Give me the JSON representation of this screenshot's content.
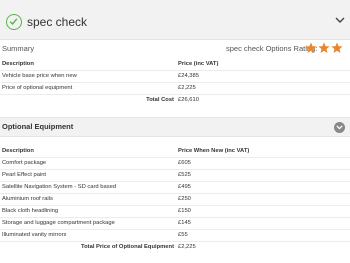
{
  "header": {
    "title": "spec check"
  },
  "summary": {
    "label": "Summary",
    "rating_label": "spec check Options Rating:",
    "rating": 3,
    "rating_max": 3,
    "star_color": "#e8862a",
    "columns": [
      "Description",
      "Price (inc VAT)"
    ],
    "rows": [
      {
        "description": "Vehicle base price when new",
        "price": "£24,385"
      },
      {
        "description": "Price of optional equipment",
        "price": "£2,225"
      }
    ],
    "total_label": "Total Cost",
    "total_value": "£26,610"
  },
  "optional": {
    "title": "Optional Equipment",
    "columns": [
      "Description",
      "Price When New (inc VAT)"
    ],
    "rows": [
      {
        "description": "Comfort package",
        "price": "£605"
      },
      {
        "description": "Pearl Effect paint",
        "price": "£525"
      },
      {
        "description": "Satellite Navigation System - SD card based",
        "price": "£495"
      },
      {
        "description": "Aluminium roof rails",
        "price": "£250"
      },
      {
        "description": "Black cloth headlining",
        "price": "£150"
      },
      {
        "description": "Storage and luggage compartment package",
        "price": "£145"
      },
      {
        "description": "Illuminated vanity mirrors",
        "price": "£55"
      }
    ],
    "total_label": "Total Price of Optional Equipment",
    "total_value": "£2,225"
  }
}
